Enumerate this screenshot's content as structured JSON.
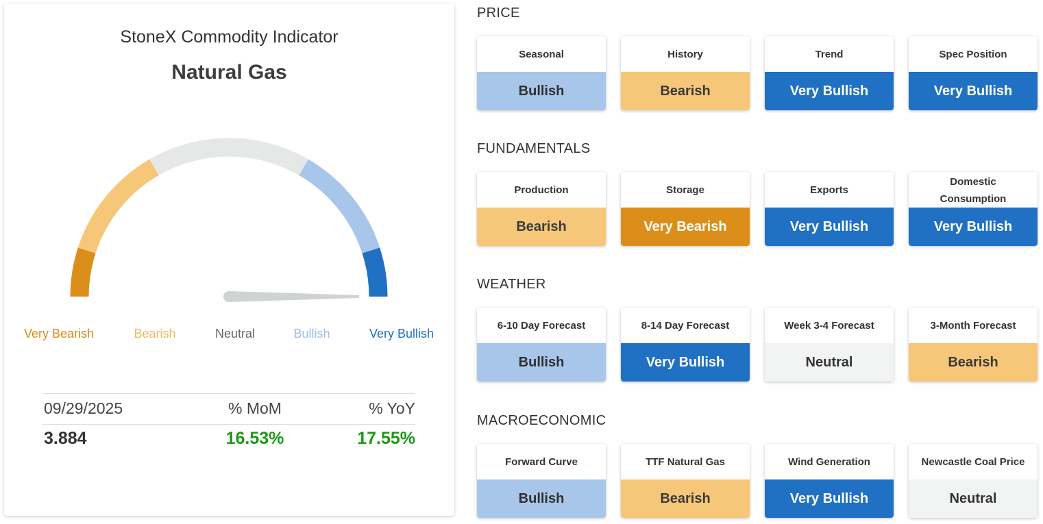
{
  "indicator": {
    "title": "StoneX Commodity Indicator",
    "commodity": "Natural Gas"
  },
  "gauge": {
    "reading": "Very Bullish",
    "labels": [
      "Very Bearish",
      "Bearish",
      "Neutral",
      "Bullish",
      "Very Bullish"
    ],
    "colors": {
      "very_bearish": "#dc8e1a",
      "bearish": "#f6c778",
      "neutral": "#e6e8e8",
      "bullish": "#a8c6ea",
      "very_bullish": "#2070c4",
      "needle": "#cfd3d3"
    }
  },
  "stats": {
    "date": "09/29/2025",
    "mom_label": "% MoM",
    "yoy_label": "% YoY",
    "price": "3.884",
    "mom": "16.53%",
    "yoy": "17.55%"
  },
  "sections": [
    {
      "title": "PRICE",
      "cards": [
        {
          "label": "Seasonal",
          "status": "Bullish"
        },
        {
          "label": "History",
          "status": "Bearish"
        },
        {
          "label": "Trend",
          "status": "Very Bullish"
        },
        {
          "label": "Spec Position",
          "status": "Very Bullish"
        }
      ]
    },
    {
      "title": "FUNDAMENTALS",
      "cards": [
        {
          "label": "Production",
          "status": "Bearish"
        },
        {
          "label": "Storage",
          "status": "Very Bearish"
        },
        {
          "label": "Exports",
          "status": "Very Bullish"
        },
        {
          "label": "Domestic Consumption",
          "status": "Very Bullish"
        }
      ]
    },
    {
      "title": "WEATHER",
      "cards": [
        {
          "label": "6-10 Day Forecast",
          "status": "Bullish"
        },
        {
          "label": "8-14 Day Forecast",
          "status": "Very Bullish"
        },
        {
          "label": "Week 3-4 Forecast",
          "status": "Neutral"
        },
        {
          "label": "3-Month Forecast",
          "status": "Bearish"
        }
      ]
    },
    {
      "title": "MACROECONOMIC",
      "cards": [
        {
          "label": "Forward Curve",
          "status": "Bullish"
        },
        {
          "label": "TTF Natural Gas",
          "status": "Bearish"
        },
        {
          "label": "Wind Generation",
          "status": "Very Bullish"
        },
        {
          "label": "Newcastle Coal Price",
          "status": "Neutral"
        }
      ]
    }
  ]
}
